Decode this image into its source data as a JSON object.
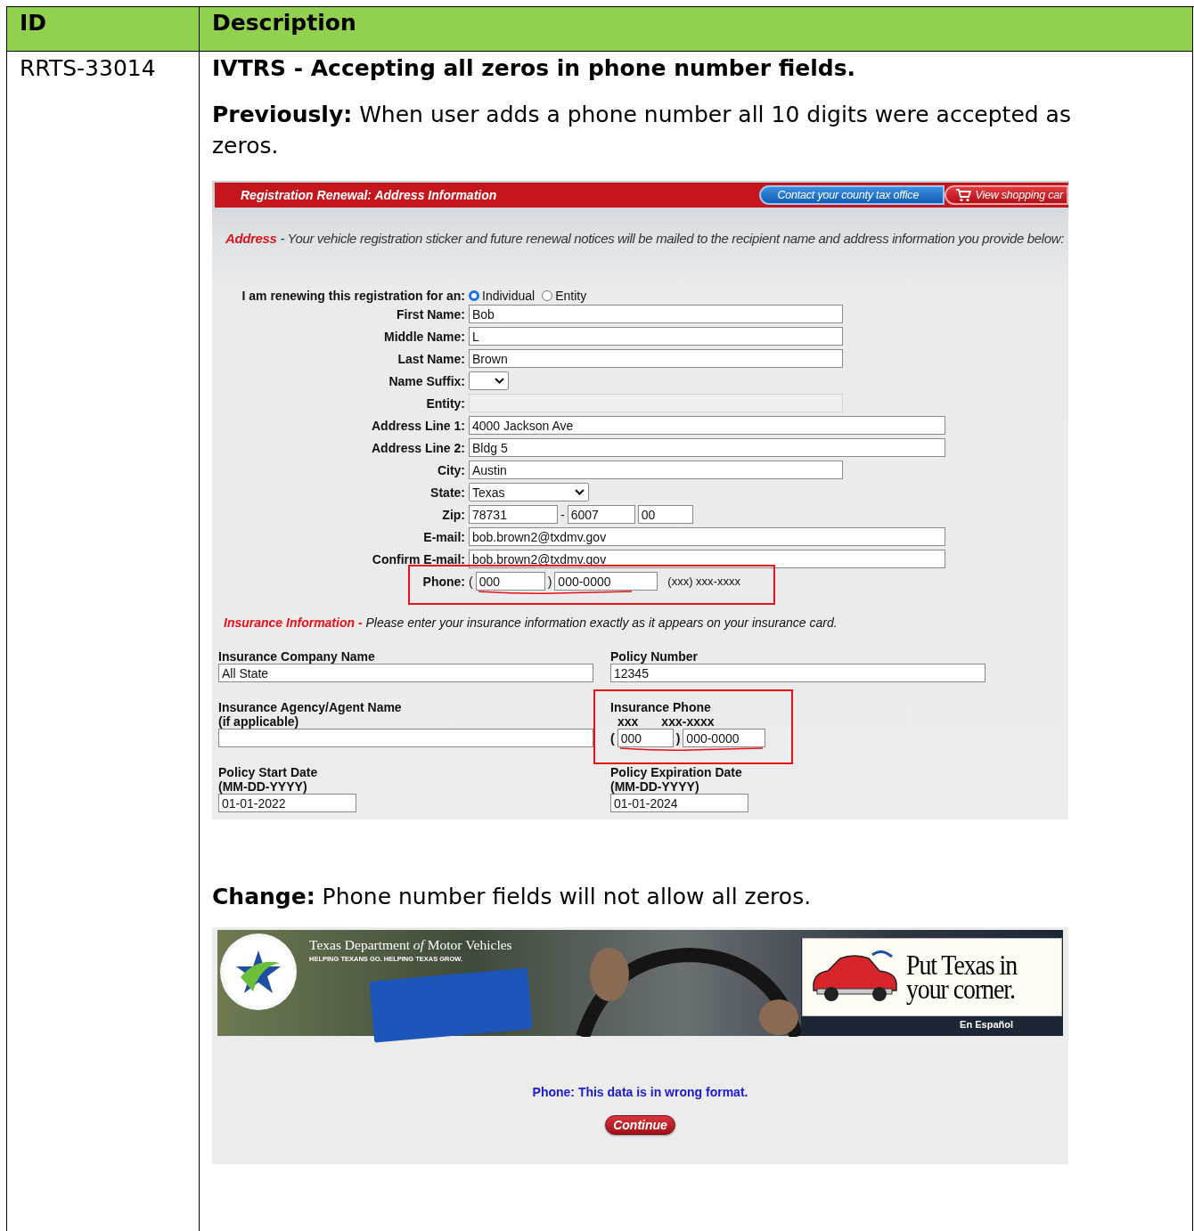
{
  "table": {
    "columns": [
      "ID",
      "Description"
    ],
    "row": {
      "id": "RRTS-33014",
      "title": "IVTRS - Accepting all zeros in phone number fields.",
      "previously": "**Previously:** When user adds a phone number all 10 digits were accepted as zeros.",
      "form_screenshot": {
        "header": {
          "title": "Registration Renewal: Address Information",
          "links": [
            "Contact your county tax office",
            "View shopping car"
          ]
        },
        "intro": {
          "label": "Address",
          "text": "- Your vehicle registration sticker and future renewal notices will be mailed to the recipient name and address information you provide below:"
        },
        "renew": {
          "label": "I am renewing this registration for an:",
          "options": [
            {
              "label": "Individual",
              "selected": true
            },
            {
              "label": "Entity",
              "selected": false
            }
          ]
        },
        "fields": [
          {
            "kind": "text",
            "label": "First Name:",
            "value": "Bob"
          },
          {
            "kind": "text",
            "label": "Middle Name:",
            "value": "L"
          },
          {
            "kind": "text",
            "label": "Last Name:",
            "value": "Brown"
          },
          {
            "kind": "select",
            "label": "Name Suffix:"
          },
          {
            "kind": "blank",
            "label": "Entity:"
          },
          {
            "kind": "wide",
            "label": "Address Line 1:",
            "value": "4000 Jackson Ave"
          },
          {
            "kind": "wide",
            "label": "Address Line 2:",
            "value": "Bldg 5"
          },
          {
            "kind": "text",
            "label": "City:",
            "value": "Austin"
          },
          {
            "kind": "select",
            "label": "State:",
            "value": "Texas"
          },
          {
            "kind": "zip",
            "label": "Zip:",
            "values": [
              "78731",
              "6007",
              "00"
            ],
            "separator": "-"
          },
          {
            "kind": "wide",
            "label": "E-mail:",
            "value": "bob.brown2@txdmv.gov"
          },
          {
            "kind": "wide",
            "label": "Confirm E-mail:",
            "value": "bob.brown2@txdmv.gov"
          },
          {
            "kind": "phone",
            "label": "Phone:",
            "open": "(",
            "close": ")",
            "values": [
              "000",
              "000-0000"
            ],
            "hint": "(xxx) xxx-xxxx",
            "highlighted": true
          }
        ],
        "insurance": {
          "label": "Insurance Information -",
          "text": "Please enter your insurance information exactly as it appears on your insurance card.",
          "items": [
            {
              "kind": "text",
              "label_lines": [
                "Insurance Company Name"
              ],
              "value": "All State"
            },
            {
              "kind": "text",
              "label_lines": [
                "Policy Number"
              ],
              "value": "12345"
            },
            {
              "kind": "text",
              "label_lines": [
                "Insurance Agency/Agent Name",
                "(if applicable)"
              ]
            },
            {
              "kind": "phone",
              "label_lines": [
                "Insurance Phone"
              ],
              "formats": [
                "xxx",
                "xxx-xxxx"
              ],
              "open": "(",
              "close": ")",
              "values": [
                "000",
                "000-0000"
              ],
              "highlighted": true
            },
            {
              "kind": "date",
              "label_lines": [
                "Policy Start Date",
                "(MM-DD-YYYY)"
              ],
              "value": "01-01-2022"
            },
            {
              "kind": "date",
              "label_lines": [
                "Policy Expiration Date",
                "(MM-DD-YYYY)"
              ],
              "value": "01-01-2024"
            }
          ]
        }
      },
      "change": "**Change:** Phone number fields will not allow all zeros.",
      "error_screenshot": {
        "banner": {
          "agency": "Texas Department *of* Motor Vehicles",
          "tagline": "HELPING TEXANS GO. HELPING TEXAS GROW.",
          "slogan": [
            "Put Texas in",
            "your corner."
          ],
          "language_link": "En Español"
        },
        "message": "Phone: This data is in wrong format.",
        "button": "Continue"
      }
    }
  }
}
